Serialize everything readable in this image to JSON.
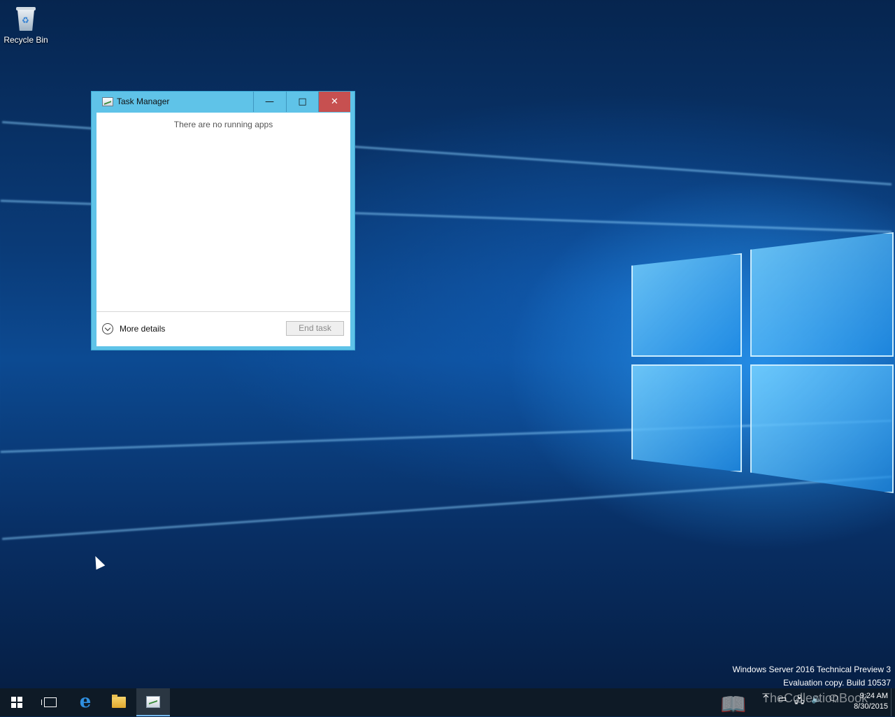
{
  "desktop": {
    "icons": [
      {
        "label": "Recycle Bin",
        "icon": "recycle-bin-icon"
      }
    ],
    "watermark": {
      "line1": "Windows Server 2016 Technical Preview 3",
      "line2": "Evaluation copy. Build 10537"
    }
  },
  "task_manager": {
    "title": "Task Manager",
    "minimize_glyph": "—",
    "maximize_glyph": "□",
    "close_glyph": "✕",
    "empty_message": "There are no running apps",
    "more_details_label": "More details",
    "end_task_label": "End task"
  },
  "taskbar": {
    "pinned": [
      {
        "name": "start-button",
        "icon": "windows-logo-icon"
      },
      {
        "name": "task-view-button",
        "icon": "task-view-icon"
      },
      {
        "name": "edge-button",
        "icon": "edge-icon"
      },
      {
        "name": "file-explorer-button",
        "icon": "folder-icon"
      },
      {
        "name": "task-manager-taskbar-button",
        "icon": "task-manager-icon",
        "active": true
      }
    ],
    "tray": {
      "overlay_text": "TheCollectionBook",
      "time": "9:24 AM",
      "date": "8/30/2015"
    }
  },
  "colors": {
    "titlebar": "#5fc3e8",
    "close_button": "#c75050",
    "taskbar": "#0e1a26",
    "desktop_blue": "#0c4a92"
  }
}
